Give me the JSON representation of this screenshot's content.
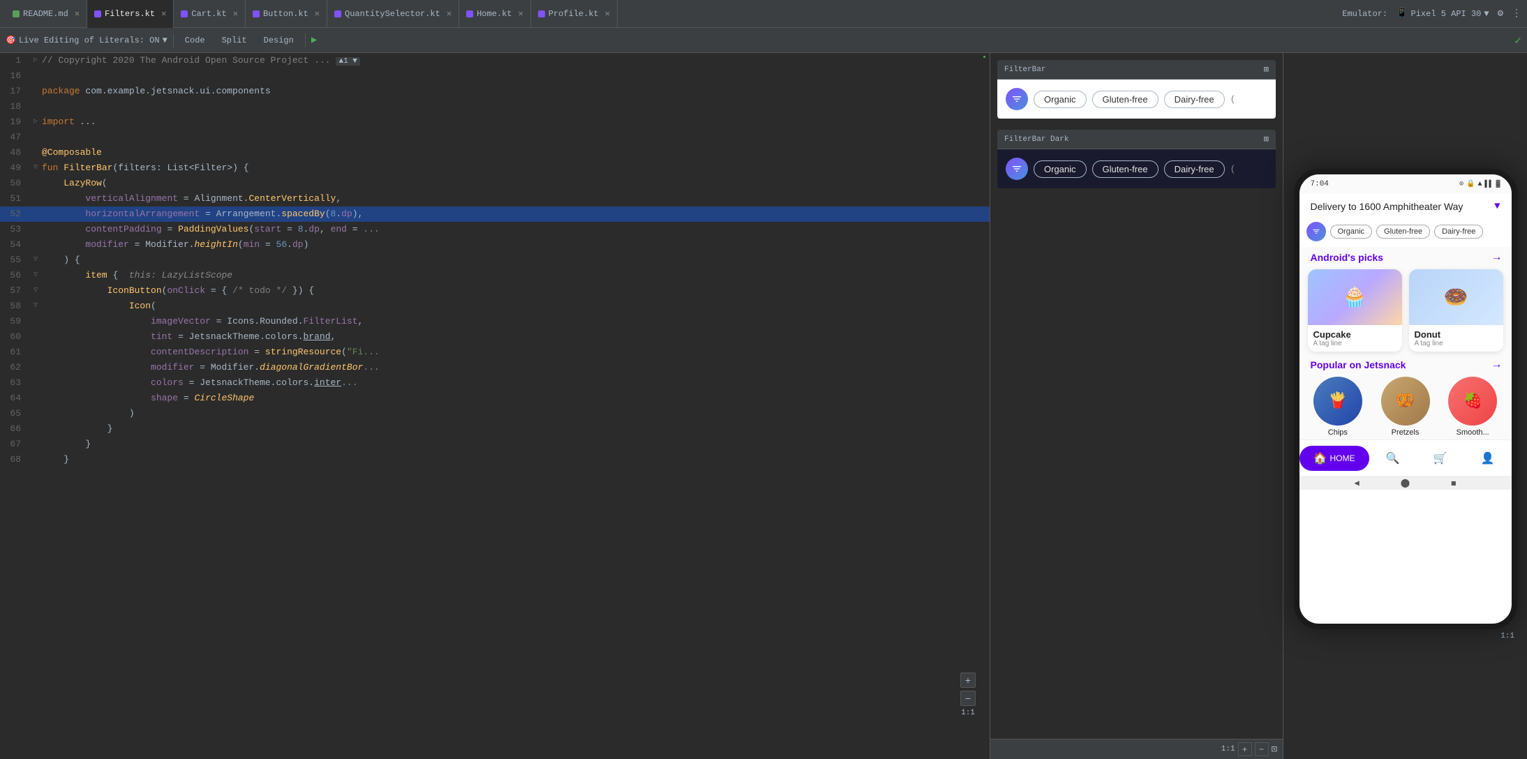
{
  "tabs": [
    {
      "label": "README.md",
      "type": "md",
      "active": false
    },
    {
      "label": "Filters.kt",
      "type": "kt",
      "active": true
    },
    {
      "label": "Cart.kt",
      "type": "kt",
      "active": false
    },
    {
      "label": "Button.kt",
      "type": "kt",
      "active": false
    },
    {
      "label": "QuantitySelector.kt",
      "type": "kt",
      "active": false
    },
    {
      "label": "Home.kt",
      "type": "kt",
      "active": false
    },
    {
      "label": "Profile.kt",
      "type": "kt",
      "active": false
    }
  ],
  "emulator": {
    "label": "Emulator:",
    "device": "Pixel 5 API 30"
  },
  "toolbar": {
    "live_editing": "Live Editing of Literals: ON",
    "code": "Code",
    "split": "Split",
    "design": "Design"
  },
  "code": {
    "lines": [
      {
        "num": "1",
        "content": "// Copyright 2020 The Android Open Source Project ...",
        "type": "comment"
      },
      {
        "num": "16",
        "content": ""
      },
      {
        "num": "17",
        "content": "package com.example.jetsnack.ui.components"
      },
      {
        "num": "18",
        "content": ""
      },
      {
        "num": "19",
        "content": "import ..."
      },
      {
        "num": "47",
        "content": ""
      },
      {
        "num": "48",
        "content": "@Composable"
      },
      {
        "num": "49",
        "content": "fun FilterBar(filters: List<Filter>) {"
      },
      {
        "num": "50",
        "content": "    LazyRow("
      },
      {
        "num": "51",
        "content": "        verticalAlignment = Alignment.CenterVertically,"
      },
      {
        "num": "52",
        "content": "        horizontalArrangement = Arrangement.spacedBy(8.dp),",
        "highlight": true
      },
      {
        "num": "53",
        "content": "        contentPadding = PaddingValues(start = 8.dp, end = ..."
      },
      {
        "num": "54",
        "content": "        modifier = Modifier.heightIn(min = 56.dp)"
      },
      {
        "num": "55",
        "content": "    ) {"
      },
      {
        "num": "56",
        "content": "        item {  this: LazyListScope"
      },
      {
        "num": "57",
        "content": "            IconButton(onClick = { /* todo */ }) {"
      },
      {
        "num": "58",
        "content": "                Icon("
      },
      {
        "num": "59",
        "content": "                    imageVector = Icons.Rounded.FilterList,"
      },
      {
        "num": "60",
        "content": "                    tint = JetsnackTheme.colors.brand,"
      },
      {
        "num": "61",
        "content": "                    contentDescription = stringResource(\"Fi..."
      },
      {
        "num": "62",
        "content": "                    modifier = Modifier.diagonalGradientBor..."
      },
      {
        "num": "63",
        "content": "                    colors = JetsnackTheme.colors.inter..."
      },
      {
        "num": "64",
        "content": "                    shape = CircleShape"
      },
      {
        "num": "65",
        "content": "                )"
      },
      {
        "num": "66",
        "content": "            }"
      },
      {
        "num": "67",
        "content": "        }"
      },
      {
        "num": "68",
        "content": "    }"
      }
    ]
  },
  "preview": {
    "filterbar_light": {
      "title": "FilterBar",
      "chips": [
        "Organic",
        "Gluten-free",
        "Dairy-free"
      ]
    },
    "filterbar_dark": {
      "title": "FilterBar Dark",
      "chips": [
        "Organic",
        "Gluten-free",
        "Dairy-free"
      ]
    }
  },
  "phone": {
    "status_time": "7:04",
    "delivery_text": "Delivery to 1600 Amphitheater Way",
    "filter_chips": [
      "Organic",
      "Gluten-free",
      "Dairy-free"
    ],
    "sections": [
      {
        "title": "Android's picks",
        "items": [
          {
            "name": "Cupcake",
            "tag": "A tag line",
            "emoji": "🧁"
          },
          {
            "name": "Donut",
            "tag": "A tag line",
            "emoji": "🍩"
          }
        ]
      },
      {
        "title": "Popular on Jetsnack",
        "items": [
          {
            "name": "Chips",
            "emoji": "🍟"
          },
          {
            "name": "Pretzels",
            "emoji": "🥨"
          },
          {
            "name": "Smooth...",
            "emoji": "🍓"
          }
        ]
      }
    ],
    "nav": [
      {
        "label": "HOME",
        "icon": "🏠",
        "active": true
      },
      {
        "label": "Search",
        "icon": "🔍",
        "active": false
      },
      {
        "label": "Cart",
        "icon": "🛒",
        "active": false
      },
      {
        "label": "Profile",
        "icon": "👤",
        "active": false
      }
    ]
  }
}
